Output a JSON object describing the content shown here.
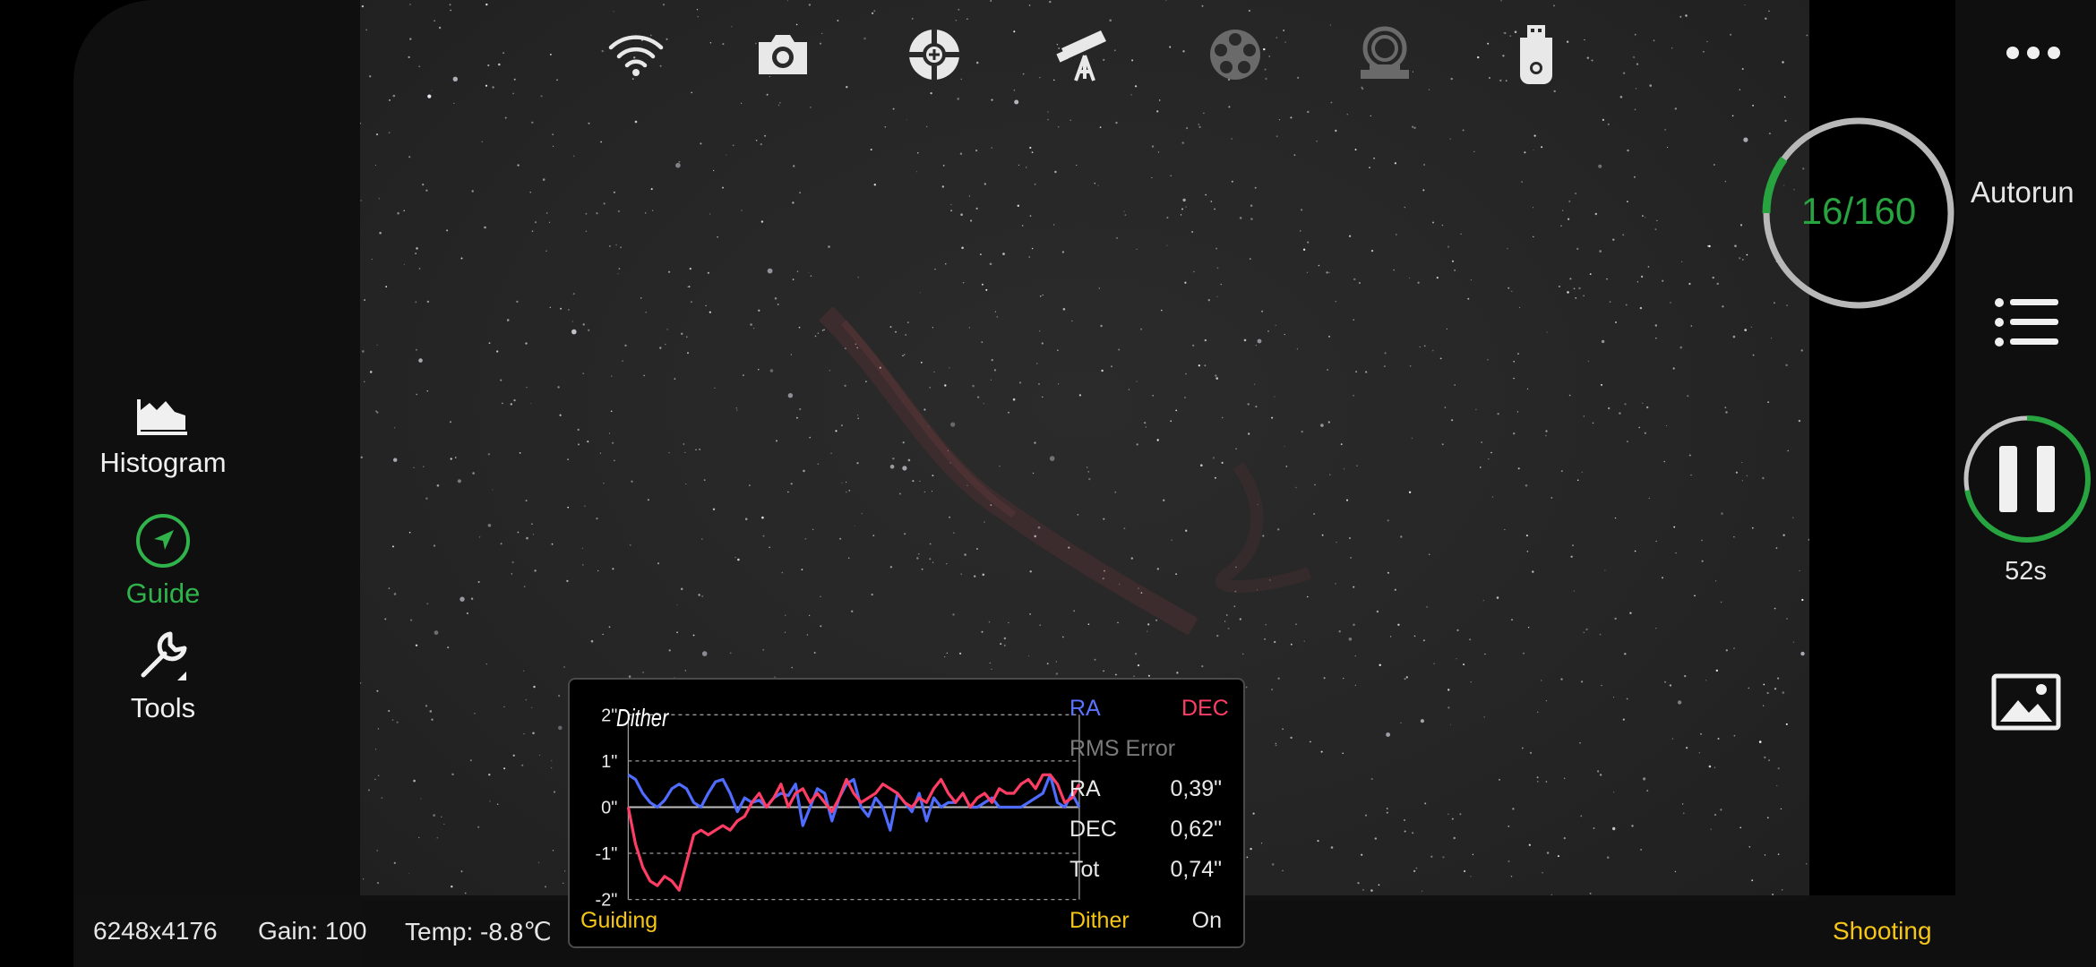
{
  "top_icons": [
    "wifi-icon",
    "camera-icon",
    "focuser-target-icon",
    "telescope-mount-icon",
    "filter-wheel-icon",
    "rotator-icon",
    "usb-drive-icon"
  ],
  "left_menu": {
    "histogram": {
      "label": "Histogram",
      "icon": "histogram-icon"
    },
    "guide": {
      "label": "Guide",
      "icon": "guide-compass-icon",
      "active": true,
      "color": "#2fb34a"
    },
    "tools": {
      "label": "Tools",
      "icon": "wrench-icon"
    }
  },
  "guide_panel": {
    "chart_label": "Dither",
    "legend": {
      "ra": "RA",
      "dec": "DEC",
      "ra_color": "#4f6cff",
      "dec_color": "#ff3d64"
    },
    "rms_title": "RMS Error",
    "rms": [
      {
        "label": "RA",
        "value": "0,39\""
      },
      {
        "label": "DEC",
        "value": "0,62\""
      },
      {
        "label": "Tot",
        "value": "0,74\""
      }
    ],
    "footer_left": "Guiding",
    "dither_label": "Dither",
    "dither_value": "On"
  },
  "chart_data": {
    "type": "line",
    "ytick_labels": [
      "2\"",
      "1\"",
      "0\"",
      "-1\"",
      "-2\""
    ],
    "ylim": [
      -2,
      2
    ],
    "grid": true,
    "series": [
      {
        "name": "RA",
        "color": "#4f6cff",
        "values": [
          0.7,
          0.6,
          0.3,
          0.1,
          0.0,
          0.15,
          0.4,
          0.5,
          0.4,
          0.1,
          0.0,
          0.3,
          0.55,
          0.6,
          0.3,
          -0.1,
          0.2,
          0.1,
          0.15,
          0.0,
          0.2,
          0.3,
          0.25,
          0.5,
          -0.4,
          0.0,
          0.4,
          0.3,
          -0.3,
          0.2,
          0.5,
          0.6,
          0.0,
          -0.2,
          0.2,
          0.0,
          -0.5,
          0.3,
          0.1,
          -0.1,
          0.3,
          -0.3,
          0.2,
          0.0,
          0.1,
          0.1,
          0.3,
          0.0,
          0.0,
          0.1,
          0.2,
          0.0,
          0.0,
          0.0,
          0.0,
          0.1,
          0.2,
          0.3,
          0.7,
          0.1,
          0.0,
          0.3,
          0.0
        ]
      },
      {
        "name": "DEC",
        "color": "#ff3d64",
        "values": [
          0.0,
          -0.8,
          -1.3,
          -1.6,
          -1.7,
          -1.5,
          -1.6,
          -1.8,
          -1.2,
          -0.6,
          -0.5,
          -0.6,
          -0.5,
          -0.4,
          -0.5,
          -0.3,
          -0.2,
          0.1,
          0.3,
          0.0,
          0.2,
          0.5,
          0.0,
          0.3,
          0.4,
          0.1,
          0.3,
          0.1,
          -0.1,
          0.2,
          0.6,
          0.3,
          0.1,
          0.2,
          0.3,
          0.5,
          0.4,
          0.3,
          0.1,
          0.0,
          0.2,
          0.1,
          0.4,
          0.6,
          0.3,
          0.1,
          0.3,
          0.0,
          0.2,
          0.3,
          0.1,
          0.4,
          0.3,
          0.3,
          0.5,
          0.6,
          0.4,
          0.7,
          0.7,
          0.5,
          0.1,
          0.2,
          0.5
        ]
      }
    ]
  },
  "status_bar": {
    "resolution": "6248x4176",
    "gain": "Gain: 100",
    "temp": "Temp: -8.8℃",
    "shooting": "Shooting"
  },
  "autorun": {
    "progress_text": "16/160",
    "progress_fraction": 0.1,
    "label": "Autorun",
    "countdown": "52s",
    "countdown_fraction": 0.72
  },
  "right_icons": [
    "more-icon",
    "sequence-list-icon",
    "pause-icon",
    "gallery-icon"
  ],
  "colors": {
    "accent_green": "#27a33f",
    "accent_yellow": "#f5c518"
  }
}
